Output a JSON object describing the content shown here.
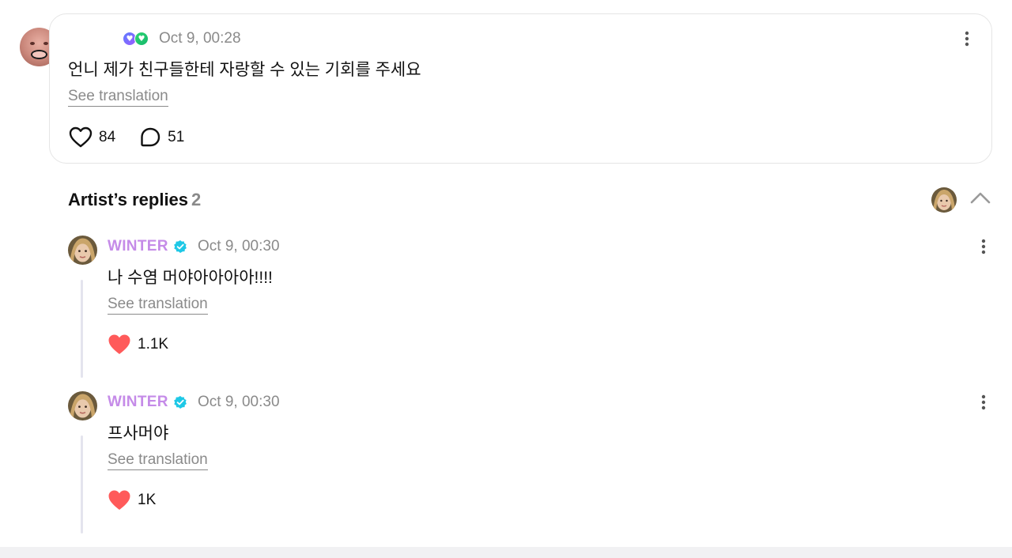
{
  "post": {
    "time": "Oct 9, 00:28",
    "text": "언니 제가 친구들한테 자랑할 수 있는 기회를 주세요",
    "translate_label": "See translation",
    "likes": "84",
    "comments": "51",
    "badges": [
      "heart-badge-purple",
      "heart-badge-green"
    ]
  },
  "replies_section": {
    "title": "Artist’s replies",
    "count": "2"
  },
  "replies": [
    {
      "author": "WINTER",
      "time": "Oct 9, 00:30",
      "text": "나 수염 머야아아아아!!!!",
      "translate_label": "See translation",
      "likes": "1.1K"
    },
    {
      "author": "WINTER",
      "time": "Oct 9, 00:30",
      "text": "프사머야",
      "translate_label": "See translation",
      "likes": "1K"
    }
  ],
  "colors": {
    "artist_name": "#c58be8",
    "verified": "#1ec8e6",
    "like_filled": "#ff5a5a",
    "muted": "#8a8a8a"
  }
}
